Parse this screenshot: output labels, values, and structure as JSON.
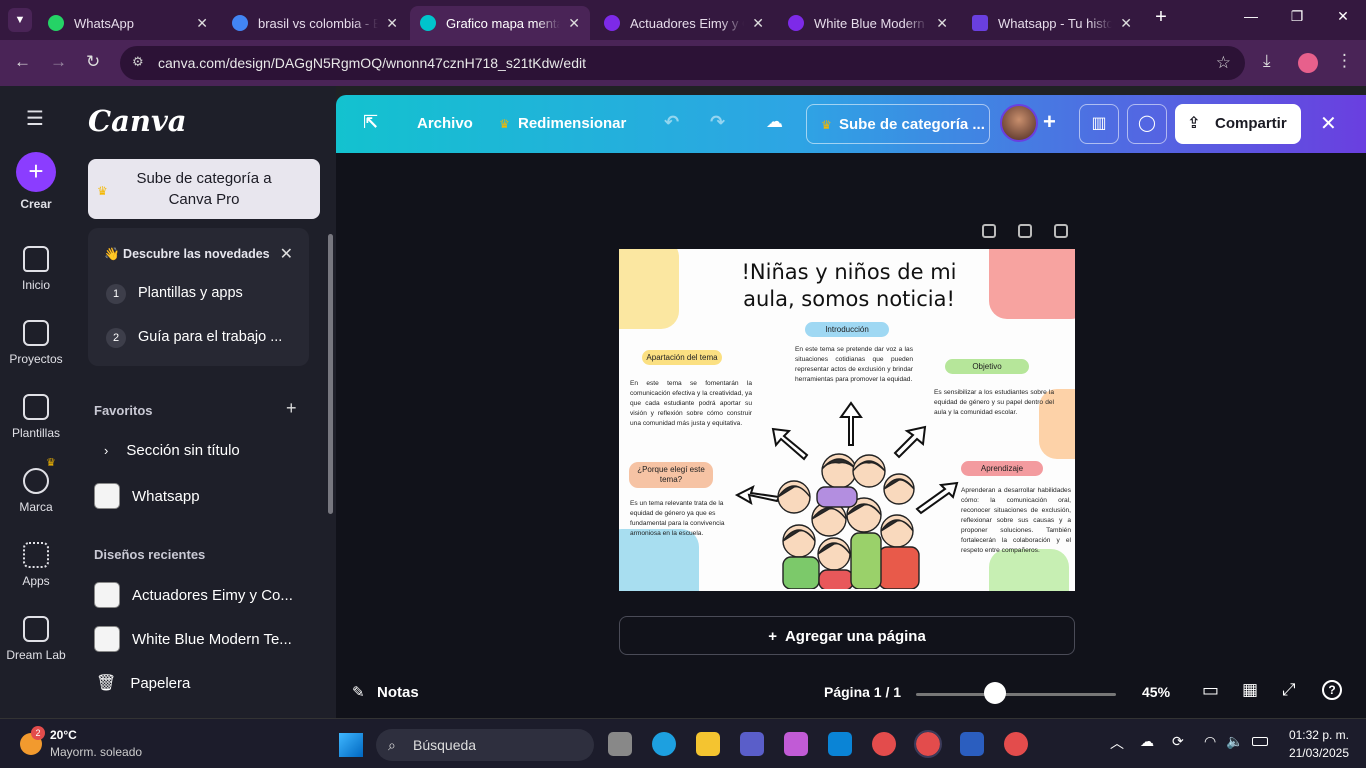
{
  "browser": {
    "tabs": [
      {
        "title": "WhatsApp",
        "fav_color": "#25d366",
        "active": false
      },
      {
        "title": "brasil vs colombia - B",
        "fav_color": "#4285f4",
        "active": false
      },
      {
        "title": "Grafico mapa mental",
        "fav_color": "#00c4cc",
        "active": true
      },
      {
        "title": "Actuadores Eimy y Co",
        "fav_color": "#7d2ae8",
        "active": false
      },
      {
        "title": "White Blue Modern Te",
        "fav_color": "#7d2ae8",
        "active": false
      },
      {
        "title": "Whatsapp - Tu histori",
        "fav_color": "#6a3fe0",
        "active": false
      }
    ],
    "url": "canva.com/design/DAGgN5RgmOQ/wnonn47cznH718_s21tKdw/edit"
  },
  "rail": {
    "create": "Crear",
    "items": [
      "Inicio",
      "Proyectos",
      "Plantillas",
      "Marca",
      "Apps",
      "Dream Lab"
    ]
  },
  "panel": {
    "logo": "Canva",
    "upgrade": "Sube de categoría a Canva Pro",
    "news_title": "👋 Descubre las novedades",
    "news_items": [
      {
        "num": "1",
        "label": "Plantillas y apps"
      },
      {
        "num": "2",
        "label": "Guía para el trabajo ..."
      }
    ],
    "favorites_title": "Favoritos",
    "favorites": [
      "Sección sin título",
      "Whatsapp"
    ],
    "recent_title": "Diseños recientes",
    "recent": [
      "Actuadores Eimy y Co...",
      "White Blue Modern Te..."
    ],
    "trash": "Papelera"
  },
  "toolbar": {
    "archivo": "Archivo",
    "resize": "Redimensionar",
    "upgrade": "Sube de categoría ...",
    "share": "Compartir"
  },
  "design": {
    "title_line1": "!Niñas y niños de mi",
    "title_line2": "aula, somos noticia!",
    "intro_label": "Introducción",
    "intro_text": "En este tema se pretende dar voz a las situaciones cotidianas que pueden representar actos de exclusión y brindar herramientas para promover la equidad.",
    "aport_label": "Apartación del tema",
    "aport_text": "En este tema se fomentarán la comunicación efectiva y la creatividad, ya que cada estudiante podrá aportar su visión y reflexión sobre cómo construir una comunidad más justa y equitativa.",
    "obj_label": "Objetivo",
    "obj_text": "Es sensibilizar a los estudiantes sobre la equidad de género y su papel dentro del aula y la comunidad escolar.",
    "why_label": "¿Porque elegí este tema?",
    "why_text": "Es un tema relevante trata de la equidad de género ya que es fundamental para la convivencia armoniosa en la escuela.",
    "learn_label": "Aprendizaje",
    "learn_text": "Aprenderan a desarrollar habilidades cómo: la comunicación oral, reconocer situaciones de exclusión, reflexionar sobre sus causas y a proponer soluciones. También fortalecerán la colaboración y el respeto entre compañeros."
  },
  "editor": {
    "add_page": "Agregar una página",
    "notes": "Notas",
    "page_indicator": "Página 1 / 1",
    "zoom": "45%",
    "zoom_value": 45
  },
  "taskbar": {
    "temp": "20°C",
    "weather": "Mayorm. soleado",
    "weather_badge": "2",
    "search": "Búsqueda",
    "time": "01:32 p. m.",
    "date": "21/03/2025"
  }
}
